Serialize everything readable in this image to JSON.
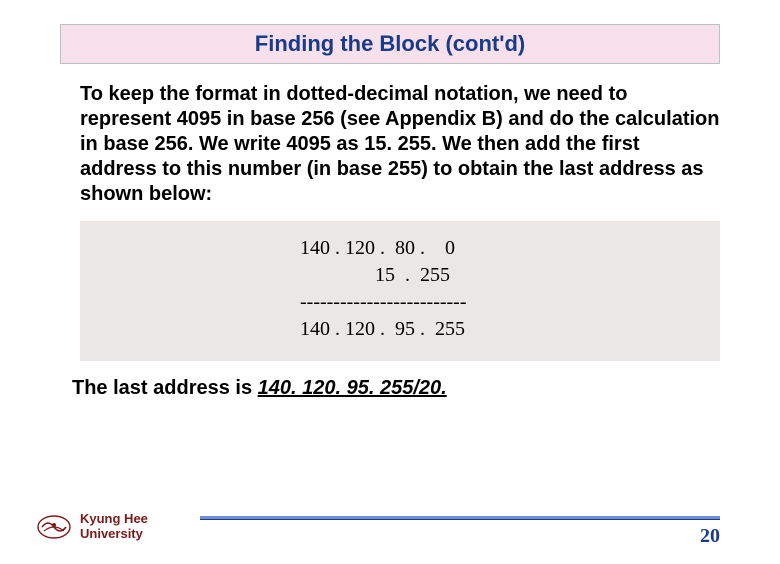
{
  "slide": {
    "title": "Finding the Block (cont'd)",
    "paragraph": "To keep the format in dotted-decimal notation, we need to represent 4095 in base 256 (see Appendix B) and do the calculation in base 256. We write 4095 as 15. 255. We then add the first address to this number (in base 255) to obtain the last address as shown below:",
    "calc": {
      "line1": "140 . 120 .  80 .    0",
      "line2": "               15  .  255",
      "divider": "-------------------------",
      "line3": "140 . 120 .  95 .  255"
    },
    "result_prefix": "The last address is ",
    "result_address": "140. 120. 95. 255/20.",
    "footer": {
      "university_line1": "Kyung Hee",
      "university_line2": "University",
      "page_number": "20"
    }
  }
}
